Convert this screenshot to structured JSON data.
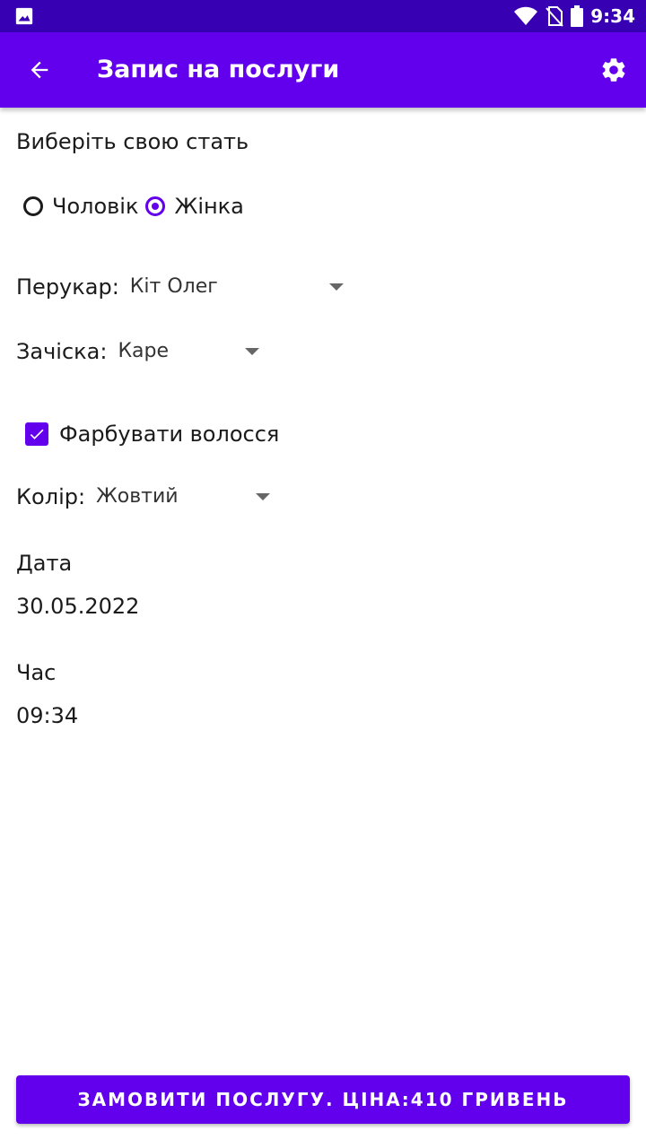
{
  "status_bar": {
    "time": "9:34",
    "icons": [
      "image-icon",
      "wifi-icon",
      "no-sim-icon",
      "battery-icon"
    ]
  },
  "app_bar": {
    "title": "Запис на послуги",
    "back_icon": "arrow-back-icon",
    "settings_icon": "gear-icon",
    "color": "#6200ee"
  },
  "form": {
    "gender_heading": "Виберіть свою стать",
    "gender_options": [
      {
        "label": "Чоловік",
        "checked": false
      },
      {
        "label": "Жінка",
        "checked": true
      }
    ],
    "barber_label": "Перукар:",
    "barber_value": "Кіт Олег",
    "haircut_label": "Зачіска:",
    "haircut_value": "Каре",
    "dye_label": "Фарбувати волосся",
    "dye_checked": true,
    "color_label": "Колір:",
    "color_value": "Жовтий",
    "date_label": "Дата",
    "date_value": "30.05.2022",
    "time_label": "Час",
    "time_value": "09:34"
  },
  "order_button": {
    "label": "ЗАМОВИТИ ПОСЛУГУ. ЦІНА:410 ГРИВЕНЬ"
  }
}
